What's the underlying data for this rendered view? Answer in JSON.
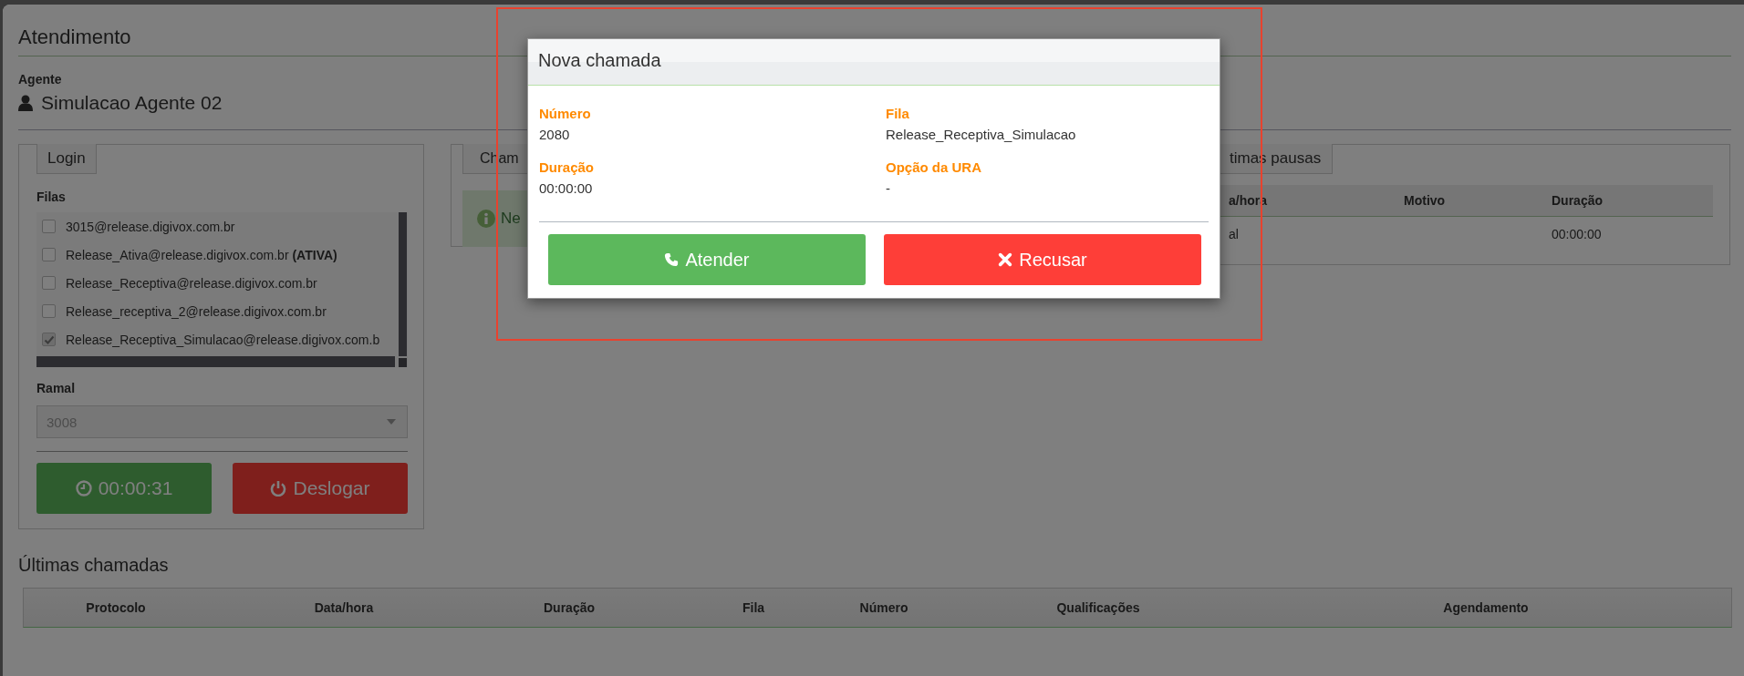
{
  "page": {
    "title": "Atendimento"
  },
  "agent": {
    "label": "Agente",
    "name": "Simulacao Agente 02"
  },
  "login_panel": {
    "tab": "Login",
    "queues_label": "Filas",
    "queues": [
      {
        "name": "3015@release.digivox.com.br",
        "checked": false
      },
      {
        "name": "Release_Ativa@release.digivox.com.br  **(ATIVA)**",
        "checked": false
      },
      {
        "name": "Release_Receptiva@release.digivox.com.br",
        "checked": false
      },
      {
        "name": "Release_receptiva_2@release.digivox.com.br",
        "checked": false
      },
      {
        "name": "Release_Receptiva_Simulacao@release.digivox.com.b",
        "checked": true
      }
    ],
    "extension_label": "Ramal",
    "extension": {
      "value": "3008",
      "disabled": true
    },
    "timer_button": "00:00:31",
    "logout_button": "Deslogar"
  },
  "calls_panel": {
    "tab": "Cham",
    "info": "Ne"
  },
  "pauses_panel": {
    "tab": "timas pausas",
    "columns": [
      "a/hora",
      "Motivo",
      "Duração"
    ],
    "rows": [
      {
        "column_1": "al",
        "duration": "00:00:00"
      }
    ]
  },
  "recent_calls": {
    "title": "Últimas chamadas",
    "columns": [
      "Protocolo",
      "Data/hora",
      "Duração",
      "Fila",
      "Número",
      "Qualificações",
      "Agendamento"
    ]
  },
  "modal": {
    "title": "Nova chamada",
    "fields": [
      {
        "label": "Número",
        "value": "2080"
      },
      {
        "label": "Fila",
        "value": "Release_Receptiva_Simulacao"
      },
      {
        "label": "Duração",
        "value": "00:00:00"
      },
      {
        "label": "Opção da URA",
        "value": "-"
      }
    ],
    "buttons": [
      {
        "label": "Atender",
        "kind": "accept"
      },
      {
        "label": "Recusar",
        "kind": "reject"
      }
    ]
  }
}
